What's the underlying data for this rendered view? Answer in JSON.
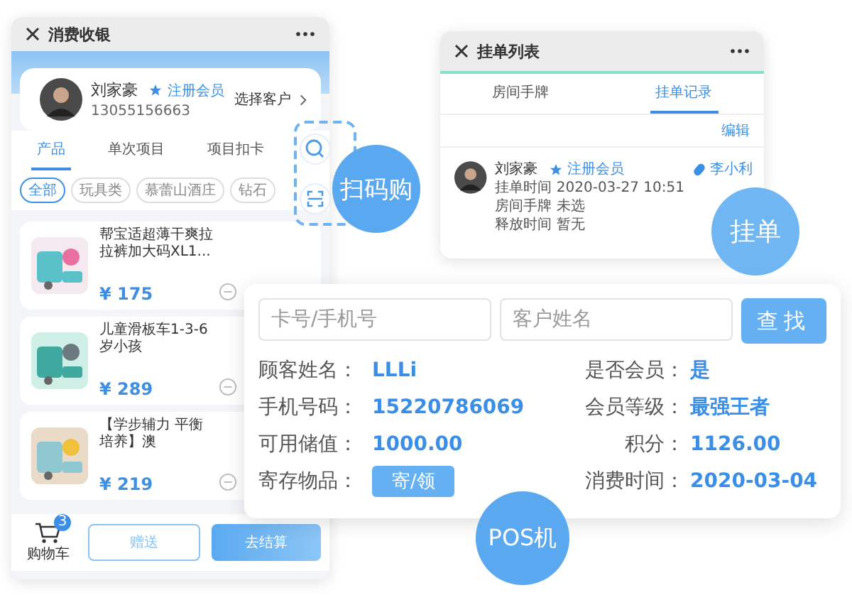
{
  "checkout": {
    "title": "消费收银",
    "customer": {
      "name": "刘家豪",
      "badge": "注册会员",
      "phone": "13055156663"
    },
    "select_customer": "选择客户",
    "tabs": [
      {
        "label": "产品",
        "selected": true
      },
      {
        "label": "单次项目",
        "selected": false
      },
      {
        "label": "项目扣卡",
        "selected": false
      }
    ],
    "categories": [
      {
        "label": "全部",
        "selected": true
      },
      {
        "label": "玩具类",
        "selected": false
      },
      {
        "label": "慕蕾山酒庄",
        "selected": false
      },
      {
        "label": "钻石",
        "selected": false
      }
    ],
    "products": [
      {
        "title": "帮宝适超薄干爽拉拉裤加大码XL1...",
        "price": "¥ 175",
        "kind": "picture"
      },
      {
        "title": "儿童滑板车1-3-6岁小孩",
        "price": "¥ 289",
        "kind": "picture"
      },
      {
        "title": "【学步辅力 平衡培养】澳",
        "price": "¥ 219",
        "kind": "picture"
      }
    ],
    "cart": {
      "label": "购物车",
      "badge": "3"
    },
    "buttons": [
      {
        "label": "赠送",
        "kind": "outline"
      },
      {
        "label": "去结算",
        "kind": "primary"
      }
    ]
  },
  "scan_badge": "扫码购",
  "hold_list": {
    "title": "挂单列表",
    "tabs": [
      {
        "label": "房间手牌",
        "selected": false
      },
      {
        "label": "挂单记录",
        "selected": true
      }
    ],
    "edit": "编辑",
    "record": {
      "name": "刘家豪",
      "badge": "注册会员",
      "lines": [
        "挂单时间 2020-03-27 10:51",
        "房间手牌 未选",
        "释放时间 暂无"
      ],
      "staff": "李小利"
    }
  },
  "hold_badge": "挂单",
  "pos": {
    "fields": [
      {
        "placeholder": "卡号/手机号"
      },
      {
        "placeholder": "客户姓名"
      }
    ],
    "search_button": "查找",
    "info": [
      {
        "label": "顾客姓名：",
        "value": "LLLi",
        "kind": "text"
      },
      {
        "label": "是否会员：",
        "value": "是",
        "kind": "text"
      },
      {
        "label": "手机号码：",
        "value": "15220786069",
        "kind": "text"
      },
      {
        "label": "会员等级：",
        "value": "最强王者",
        "kind": "text"
      },
      {
        "label": "可用储值：",
        "value": "1000.00",
        "kind": "text"
      },
      {
        "label": "积分：",
        "value": "1126.00",
        "kind": "text"
      },
      {
        "label": "寄存物品：",
        "value": "寄/领",
        "kind": "button"
      },
      {
        "label": "消费时间：",
        "value": "2020-03-04",
        "kind": "text"
      }
    ]
  },
  "pos_badge": "POS机"
}
